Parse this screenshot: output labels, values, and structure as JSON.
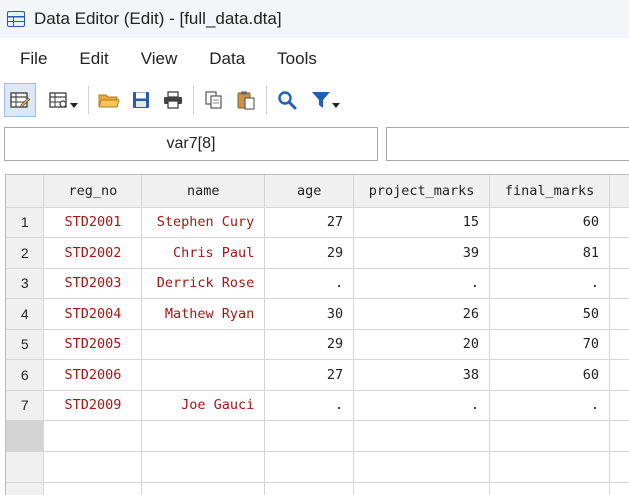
{
  "window": {
    "title": "Data Editor (Edit) - [full_data.dta]",
    "app_icon": "table-icon"
  },
  "menu": {
    "items": [
      "File",
      "Edit",
      "View",
      "Data",
      "Tools"
    ]
  },
  "toolbar": {
    "icons": [
      "edit-mode-icon",
      "browse-mode-icon",
      "open-folder-icon",
      "save-icon",
      "print-icon",
      "copy-icon",
      "paste-icon",
      "search-icon",
      "filter-icon"
    ]
  },
  "varbar": {
    "cell_ref": "var7[8]",
    "value": ""
  },
  "grid": {
    "columns": [
      "reg_no",
      "name",
      "age",
      "project_marks",
      "final_marks"
    ],
    "rows": [
      {
        "n": "1",
        "reg_no": "STD2001",
        "name": "Stephen Cury",
        "age": "27",
        "project_marks": "15",
        "final_marks": "60"
      },
      {
        "n": "2",
        "reg_no": "STD2002",
        "name": "Chris Paul",
        "age": "29",
        "project_marks": "39",
        "final_marks": "81"
      },
      {
        "n": "3",
        "reg_no": "STD2003",
        "name": "Derrick Rose",
        "age": ".",
        "project_marks": ".",
        "final_marks": "."
      },
      {
        "n": "4",
        "reg_no": "STD2004",
        "name": "Mathew Ryan",
        "age": "30",
        "project_marks": "26",
        "final_marks": "50"
      },
      {
        "n": "5",
        "reg_no": "STD2005",
        "name": "",
        "age": "29",
        "project_marks": "20",
        "final_marks": "70"
      },
      {
        "n": "6",
        "reg_no": "STD2006",
        "name": "",
        "age": "27",
        "project_marks": "38",
        "final_marks": "60"
      },
      {
        "n": "7",
        "reg_no": "STD2009",
        "name": "Joe Gauci",
        "age": ".",
        "project_marks": ".",
        "final_marks": "."
      }
    ]
  },
  "colors": {
    "string_value": "#a01818",
    "header_bg": "#f0f0f0",
    "accent": "#2a5aa8"
  }
}
